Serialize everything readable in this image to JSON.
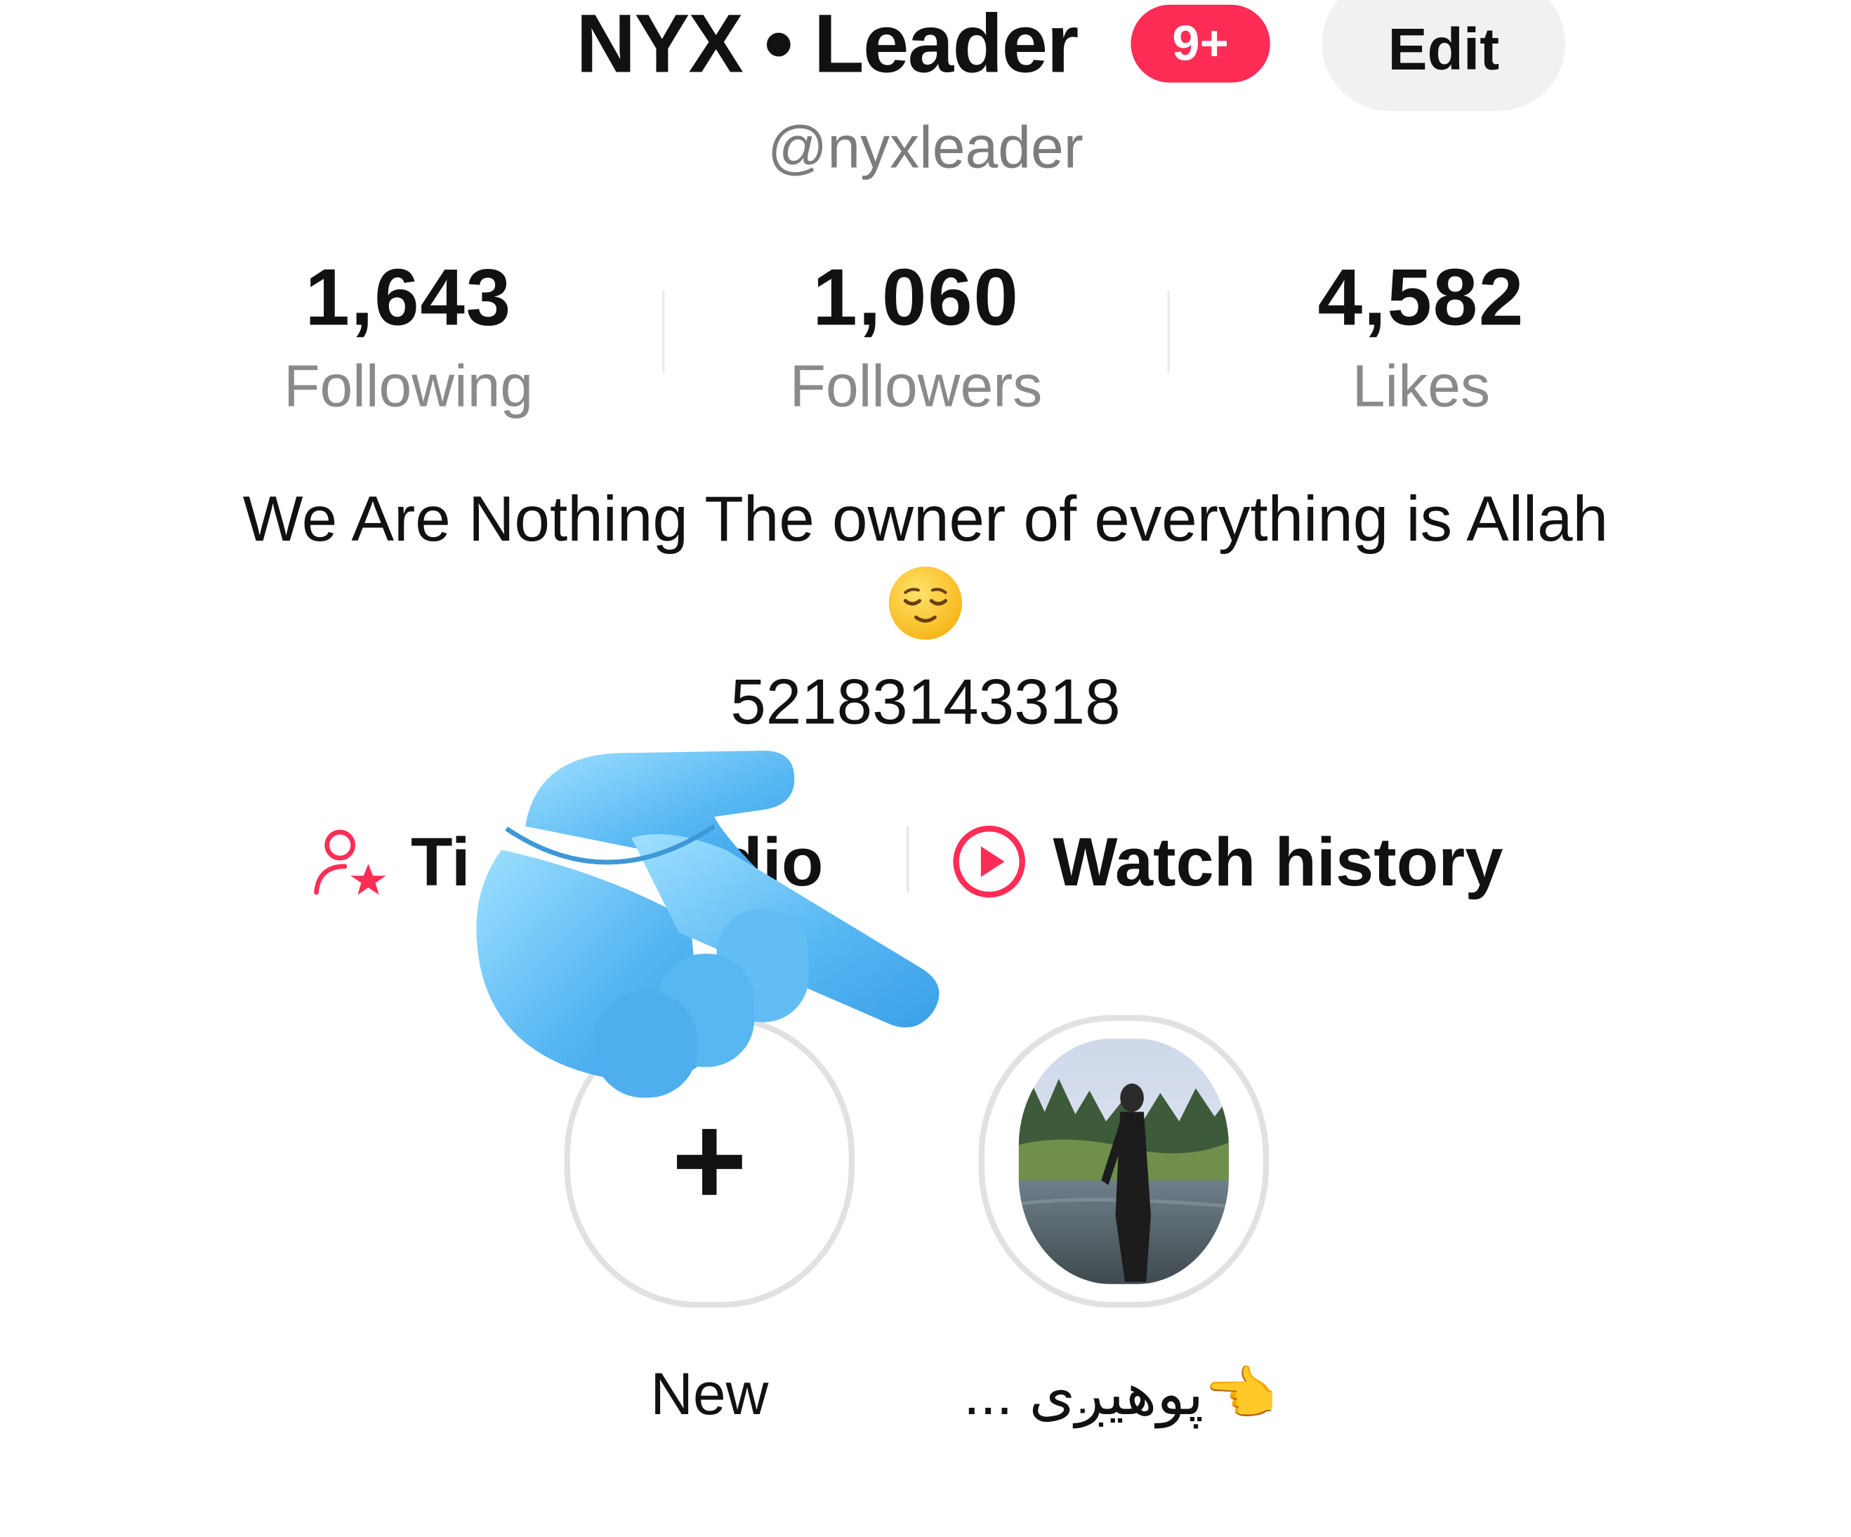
{
  "profile": {
    "display_name": "NYX • Leader",
    "notification_badge": "9+",
    "edit_label": "Edit",
    "handle": "@nyxleader"
  },
  "stats": [
    {
      "value": "1,643",
      "label": "Following"
    },
    {
      "value": "1,060",
      "label": "Followers"
    },
    {
      "value": "4,582",
      "label": "Likes"
    }
  ],
  "bio": {
    "text": "We Are Nothing The owner of everything is Allah",
    "emoji": "relieved-face-icon",
    "phone": "52183143318"
  },
  "links": {
    "studio_label": "TikTok Studio",
    "studio_visible_prefix": "Ti",
    "studio_visible_suffix": "dio",
    "studio_icon": "person-star-icon",
    "history_label": "Watch history",
    "history_icon": "play-circle-icon"
  },
  "highlights": [
    {
      "label": "New",
      "icon": "plus-icon"
    },
    {
      "label": "👈پوهیږی ...",
      "icon": "photo-thumbnail"
    }
  ],
  "colors": {
    "accent": "#ff2c55",
    "muted_text": "#8a8a8a",
    "ring": "#e1e1e1"
  }
}
